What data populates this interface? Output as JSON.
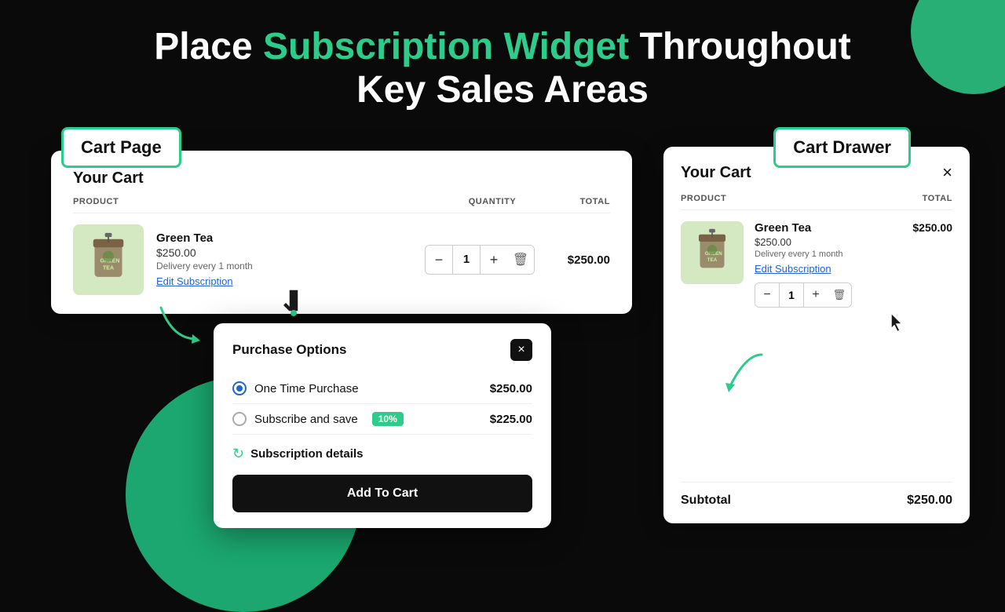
{
  "page": {
    "background_color": "#0a0a0a"
  },
  "heading": {
    "line1_start": "Place ",
    "line1_highlight": "Subscription Widget",
    "line1_end": " Throughout",
    "line2": "Key Sales Areas"
  },
  "cart_page_label": "Cart Page",
  "cart_drawer_label": "Cart Drawer",
  "cart_page_panel": {
    "title": "Your Cart",
    "col_product": "PRODUCT",
    "col_quantity": "QUANTITY",
    "col_total": "TOTAL",
    "product": {
      "name": "Green Tea",
      "price": "$250.00",
      "delivery": "Delivery every 1 month",
      "edit_link": "Edit Subscription",
      "quantity": "1",
      "total": "$250.00"
    }
  },
  "purchase_options": {
    "title": "Purchase Options",
    "options": [
      {
        "id": "one-time",
        "label": "One Time Purchase",
        "selected": true,
        "price": "$250.00",
        "badge": null
      },
      {
        "id": "subscribe",
        "label": "Subscribe and save",
        "selected": false,
        "price": "$225.00",
        "badge": "10%"
      }
    ],
    "subscription_details_label": "Subscription details",
    "add_to_cart_btn": "Add To Cart",
    "close_btn": "×"
  },
  "cart_drawer_panel": {
    "title": "Your Cart",
    "close_btn": "×",
    "col_product": "PRODUCT",
    "col_total": "TOTAL",
    "product": {
      "name": "Green Tea",
      "price": "$250.00",
      "delivery": "Delivery every 1 month",
      "edit_link": "Edit Subscription",
      "quantity": "1",
      "row_total": "$250.00"
    },
    "subtotal_label": "Subtotal",
    "subtotal_amount": "$250.00"
  },
  "icons": {
    "minus": "−",
    "plus": "+",
    "trash": "🗑",
    "refresh": "↻",
    "close": "×",
    "cursor": "↗"
  }
}
